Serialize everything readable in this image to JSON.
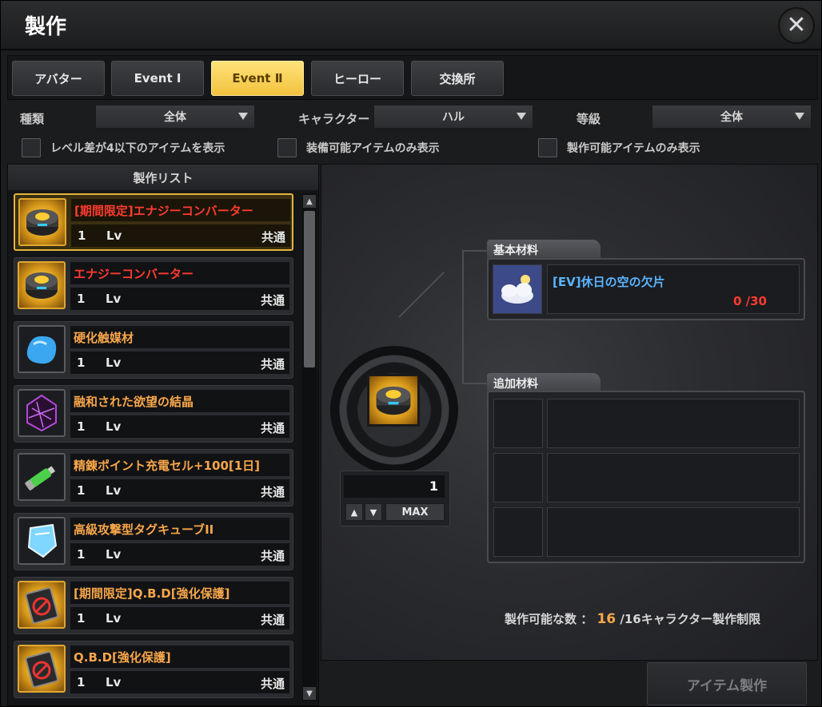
{
  "window": {
    "title": "製作",
    "close_label": "✕"
  },
  "tabs": [
    {
      "label": "アバター"
    },
    {
      "label": "Event Ⅰ"
    },
    {
      "label": "Event Ⅱ",
      "active": true
    },
    {
      "label": "ヒーロー"
    },
    {
      "label": "交換所"
    }
  ],
  "filters": {
    "type_label": "種類",
    "type_value": "全体",
    "character_label": "キャラクター",
    "character_value": "ハル",
    "grade_label": "等級",
    "grade_value": "全体"
  },
  "checkboxes": {
    "level_diff": "レベル差が4以下のアイテムを表示",
    "equippable_only": "装備可能アイテムのみ表示",
    "craftable_only": "製作可能アイテムのみ表示"
  },
  "list": {
    "header": "製作リスト",
    "items": [
      {
        "name": "[期間限定]エナジーコンバーター",
        "level": "1",
        "lv_label": "Lv",
        "scope": "共通",
        "icon": "energy-converter-icon",
        "color": "red",
        "selected": true
      },
      {
        "name": "エナジーコンバーター",
        "level": "1",
        "lv_label": "Lv",
        "scope": "共通",
        "icon": "energy-converter-icon",
        "color": "red"
      },
      {
        "name": "硬化触媒材",
        "level": "1",
        "lv_label": "Lv",
        "scope": "共通",
        "icon": "blue-crystal-icon",
        "color": "orange"
      },
      {
        "name": "融和された欲望の結晶",
        "level": "1",
        "lv_label": "Lv",
        "scope": "共通",
        "icon": "purple-crystal-icon",
        "color": "orange"
      },
      {
        "name": "精錬ポイント充電セル+100[1日]",
        "level": "1",
        "lv_label": "Lv",
        "scope": "共通",
        "icon": "battery-cell-icon",
        "color": "orange"
      },
      {
        "name": "高級攻撃型タグキューブII",
        "level": "1",
        "lv_label": "Lv",
        "scope": "共通",
        "icon": "ice-cube-icon",
        "color": "orange"
      },
      {
        "name": "[期間限定]Q.B.D[強化保護]",
        "level": "1",
        "lv_label": "Lv",
        "scope": "共通",
        "icon": "qbd-shield-icon",
        "color": "orange"
      },
      {
        "name": "Q.B.D[強化保護]",
        "level": "1",
        "lv_label": "Lv",
        "scope": "共通",
        "icon": "qbd-shield-icon",
        "color": "orange"
      }
    ]
  },
  "detail": {
    "quantity": "1",
    "max_label": "MAX",
    "basic_materials_label": "基本材料",
    "basic_material": {
      "name": "[EV]休日の空の欠片",
      "count": "0 /30",
      "icon": "cloud-sky-icon"
    },
    "extra_materials_label": "追加材料",
    "can_make_label": "製作可能な数 ：",
    "can_make_count": "16",
    "can_make_suffix": "/16キャラクター製作制限",
    "craft_button": "アイテム製作"
  },
  "colors": {
    "accent": "#f2c23e",
    "red_text": "#ff3b30",
    "orange_text": "#f7a64a"
  }
}
